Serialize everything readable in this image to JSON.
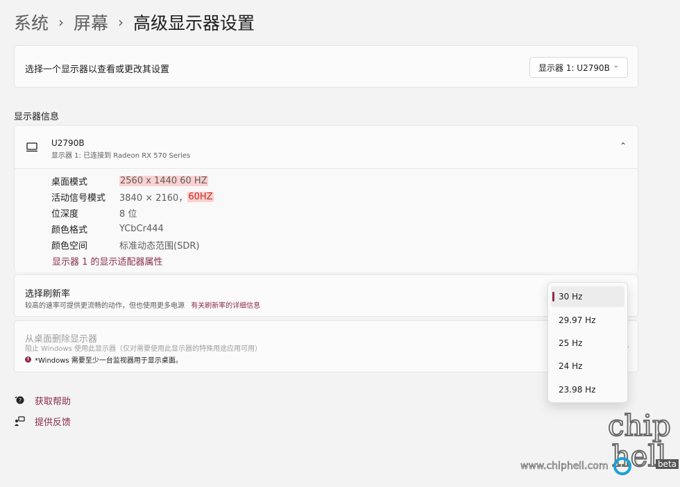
{
  "breadcrumb": {
    "items": [
      "系统",
      "屏幕"
    ],
    "separator": "›",
    "current": "高级显示器设置"
  },
  "select_display": {
    "label": "选择一个显示器以查看或更改其设置",
    "value": "显示器 1: U2790B"
  },
  "section_title": "显示器信息",
  "monitor": {
    "name": "U2790B",
    "subtitle": "显示器 1: 已连接到 Radeon RX 570 Series",
    "rows": [
      {
        "key": "桌面模式",
        "value": "2560 x 1440 60 HZ"
      },
      {
        "key": "活动信号模式",
        "value": "3840 × 2160，",
        "highlight": "60HZ"
      },
      {
        "key": "位深度",
        "value": "8 位"
      },
      {
        "key": "颜色格式",
        "value": "YCbCr444"
      },
      {
        "key": "颜色空间",
        "value": "标准动态范围(SDR)"
      }
    ],
    "adapter_link": "显示器 1 的显示适配器属性"
  },
  "refresh": {
    "title": "选择刷新率",
    "desc": "较高的速率可提供更流畅的动作，但也使用更多电源",
    "link": "有关刷新率的详细信息"
  },
  "remove": {
    "title": "从桌面删除显示器",
    "desc": "阻止 Windows 使用此显示器（仅对需要使用此显示器的特殊用途应用可用）",
    "warning": "*Windows 需要至少一台监视器用于显示桌面。"
  },
  "help": {
    "get_help": "获取帮助",
    "feedback": "提供反馈"
  },
  "refresh_options": [
    "30 Hz",
    "29.97 Hz",
    "25 Hz",
    "24 Hz",
    "23.98 Hz"
  ],
  "selected_refresh": "30 Hz",
  "watermark": {
    "logo": "chip hell",
    "url": "www.chiphell.com",
    "beta": "beta"
  },
  "colors": {
    "accent": "#8a2c4d",
    "highlight_bg": "#fbd1d1",
    "highlight_text": "#c42b1c"
  },
  "icons": {
    "monitor": "monitor-icon",
    "help": "help-icon",
    "feedback": "feedback-icon",
    "chevron_down": "chevron-down-icon",
    "chevron_up": "chevron-up-icon",
    "info": "info-icon"
  }
}
